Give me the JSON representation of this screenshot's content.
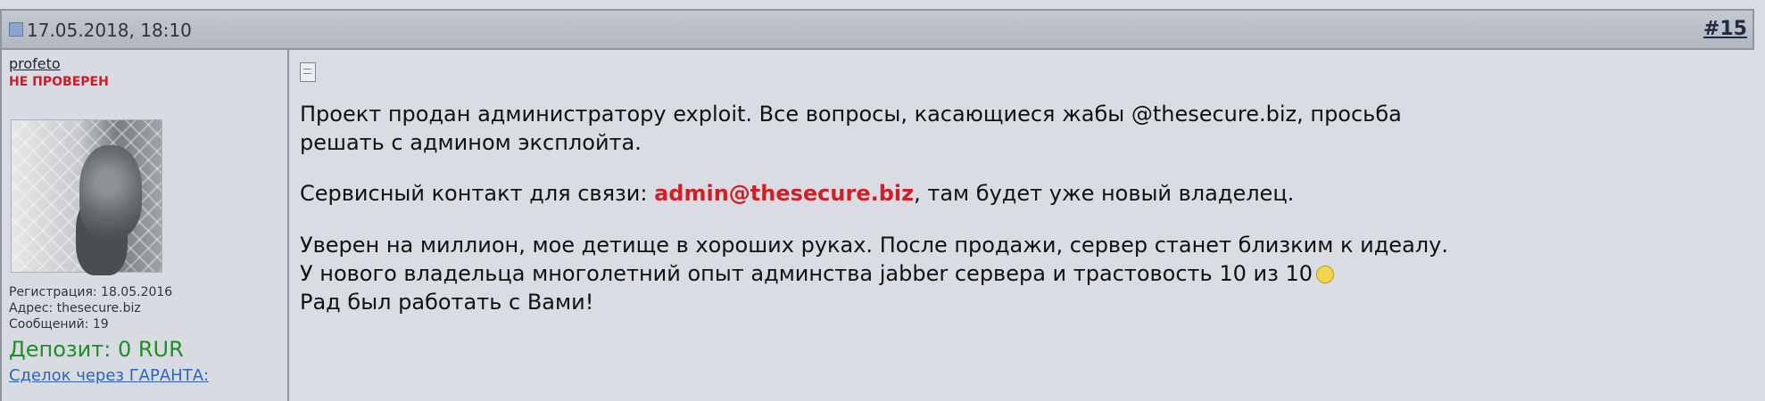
{
  "post": {
    "date": "17.05.2018, 18:10",
    "number": "#15"
  },
  "user": {
    "username": "profeto",
    "status": "НЕ ПРОВЕРЕН",
    "registration": "Регистрация: 18.05.2016",
    "address": "Адрес: thesecure.biz",
    "messages": "Сообщений: 19",
    "deposit": "Депозит: 0 RUR",
    "deal_link": "Сделок через ГАРАНТА:"
  },
  "message": {
    "p1_line1": "Проект продан администратору exploit. Все вопросы, касающиеся жабы @thesecure.biz, просьба",
    "p1_line2": "решать с админом эксплойта.",
    "p2_prefix": "Сервисный контакт для связи: ",
    "p2_email": "admin@thesecure.biz",
    "p2_suffix": ", там будет уже новый владелец.",
    "p3_line1": "Уверен на миллион, мое детище в хороших руках. После продажи, сервер станет близким к идеалу.",
    "p3_line2": "У нового владельца многолетний опыт админства jabber сервера и трастовость 10 из 10",
    "p3_line3": "Рад был работать с Вами!"
  },
  "icons": {
    "post_icon": "document-icon",
    "date_icon": "post-date-icon",
    "smiley": "smiley-icon"
  },
  "colors": {
    "status": "#d0192a",
    "deposit": "#1f8e24",
    "email": "#d01f26",
    "link": "#2f63ba"
  }
}
